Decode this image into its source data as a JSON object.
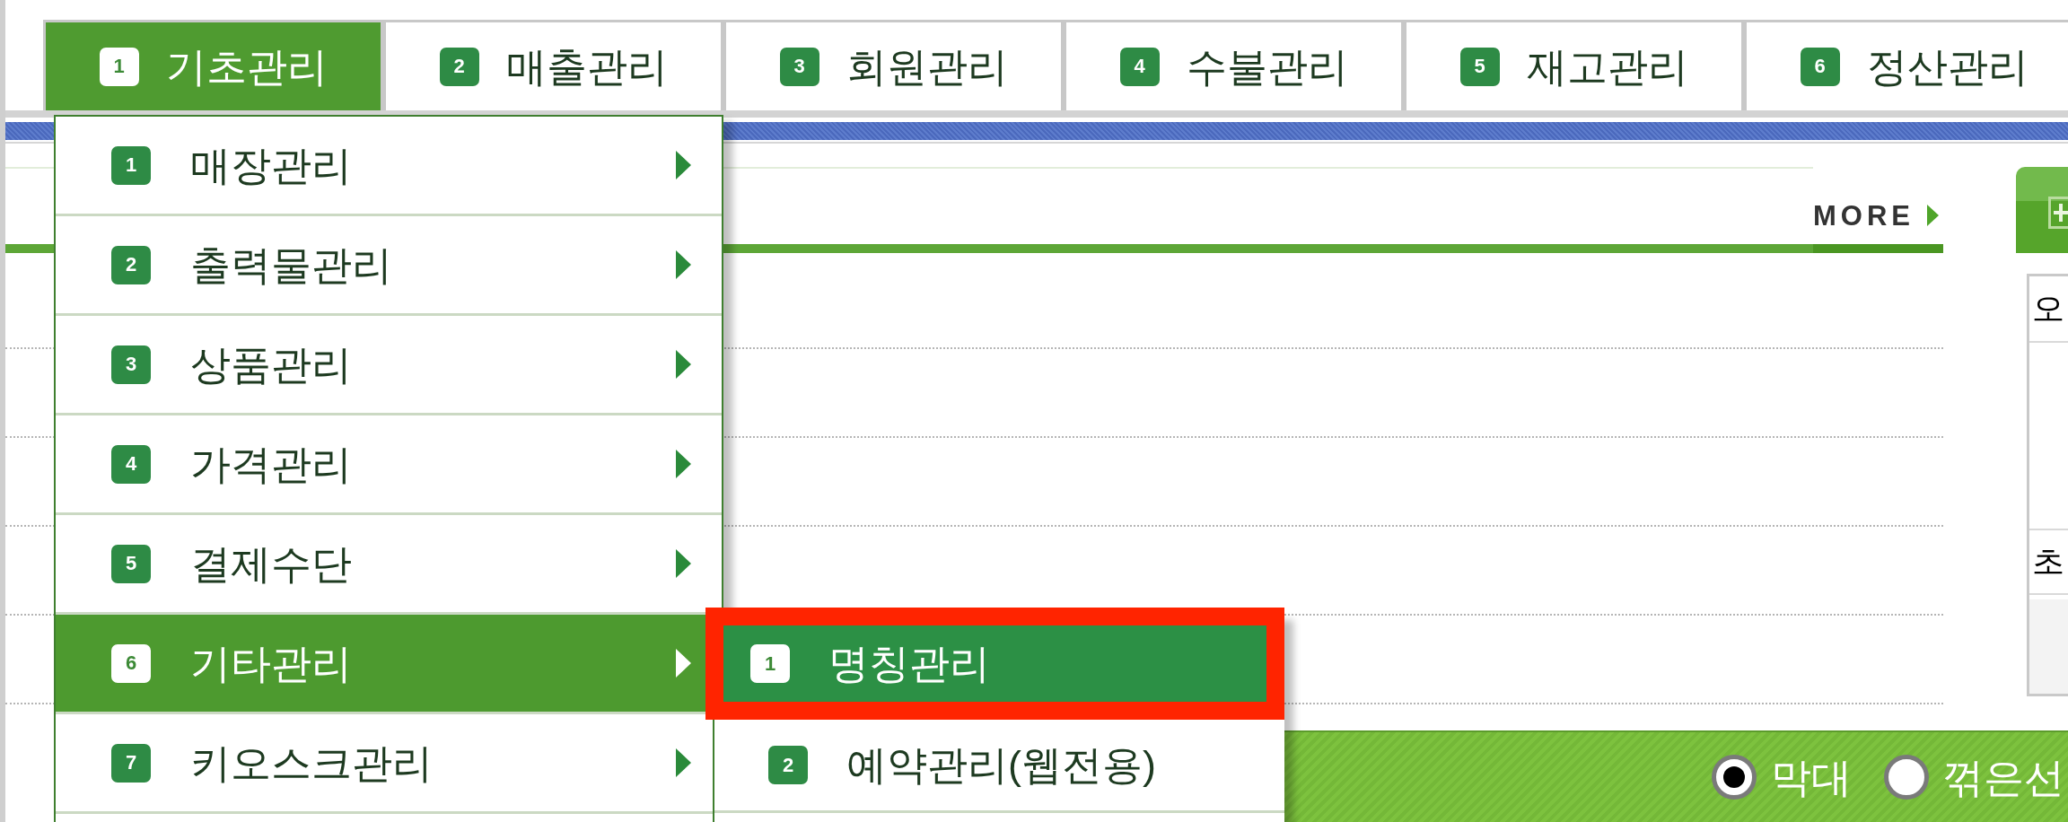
{
  "tabs": [
    {
      "number": "1",
      "label": "기초관리",
      "selected": true
    },
    {
      "number": "2",
      "label": "매출관리",
      "selected": false
    },
    {
      "number": "3",
      "label": "회원관리",
      "selected": false
    },
    {
      "number": "4",
      "label": "수불관리",
      "selected": false
    },
    {
      "number": "5",
      "label": "재고관리",
      "selected": false
    },
    {
      "number": "6",
      "label": "정산관리",
      "selected": false
    }
  ],
  "menu": {
    "items": [
      {
        "number": "1",
        "label": "매장관리",
        "selected": false,
        "has_submenu": true
      },
      {
        "number": "2",
        "label": "출력물관리",
        "selected": false,
        "has_submenu": true
      },
      {
        "number": "3",
        "label": "상품관리",
        "selected": false,
        "has_submenu": true
      },
      {
        "number": "4",
        "label": "가격관리",
        "selected": false,
        "has_submenu": true
      },
      {
        "number": "5",
        "label": "결제수단",
        "selected": false,
        "has_submenu": true
      },
      {
        "number": "6",
        "label": "기타관리",
        "selected": true,
        "has_submenu": true
      },
      {
        "number": "7",
        "label": "키오스크관리",
        "selected": false,
        "has_submenu": true
      }
    ]
  },
  "submenu": {
    "items": [
      {
        "number": "1",
        "label": "명칭관리",
        "selected": true,
        "highlighted": true
      },
      {
        "number": "2",
        "label": "예약관리(웹전용)",
        "selected": false,
        "highlighted": false
      }
    ]
  },
  "panel": {
    "more_link": "MORE"
  },
  "side_panel": {
    "cells": [
      "오",
      "초"
    ]
  },
  "chart_options": [
    {
      "label": "막대",
      "selected": true
    },
    {
      "label": "꺾은선",
      "selected": false
    }
  ]
}
